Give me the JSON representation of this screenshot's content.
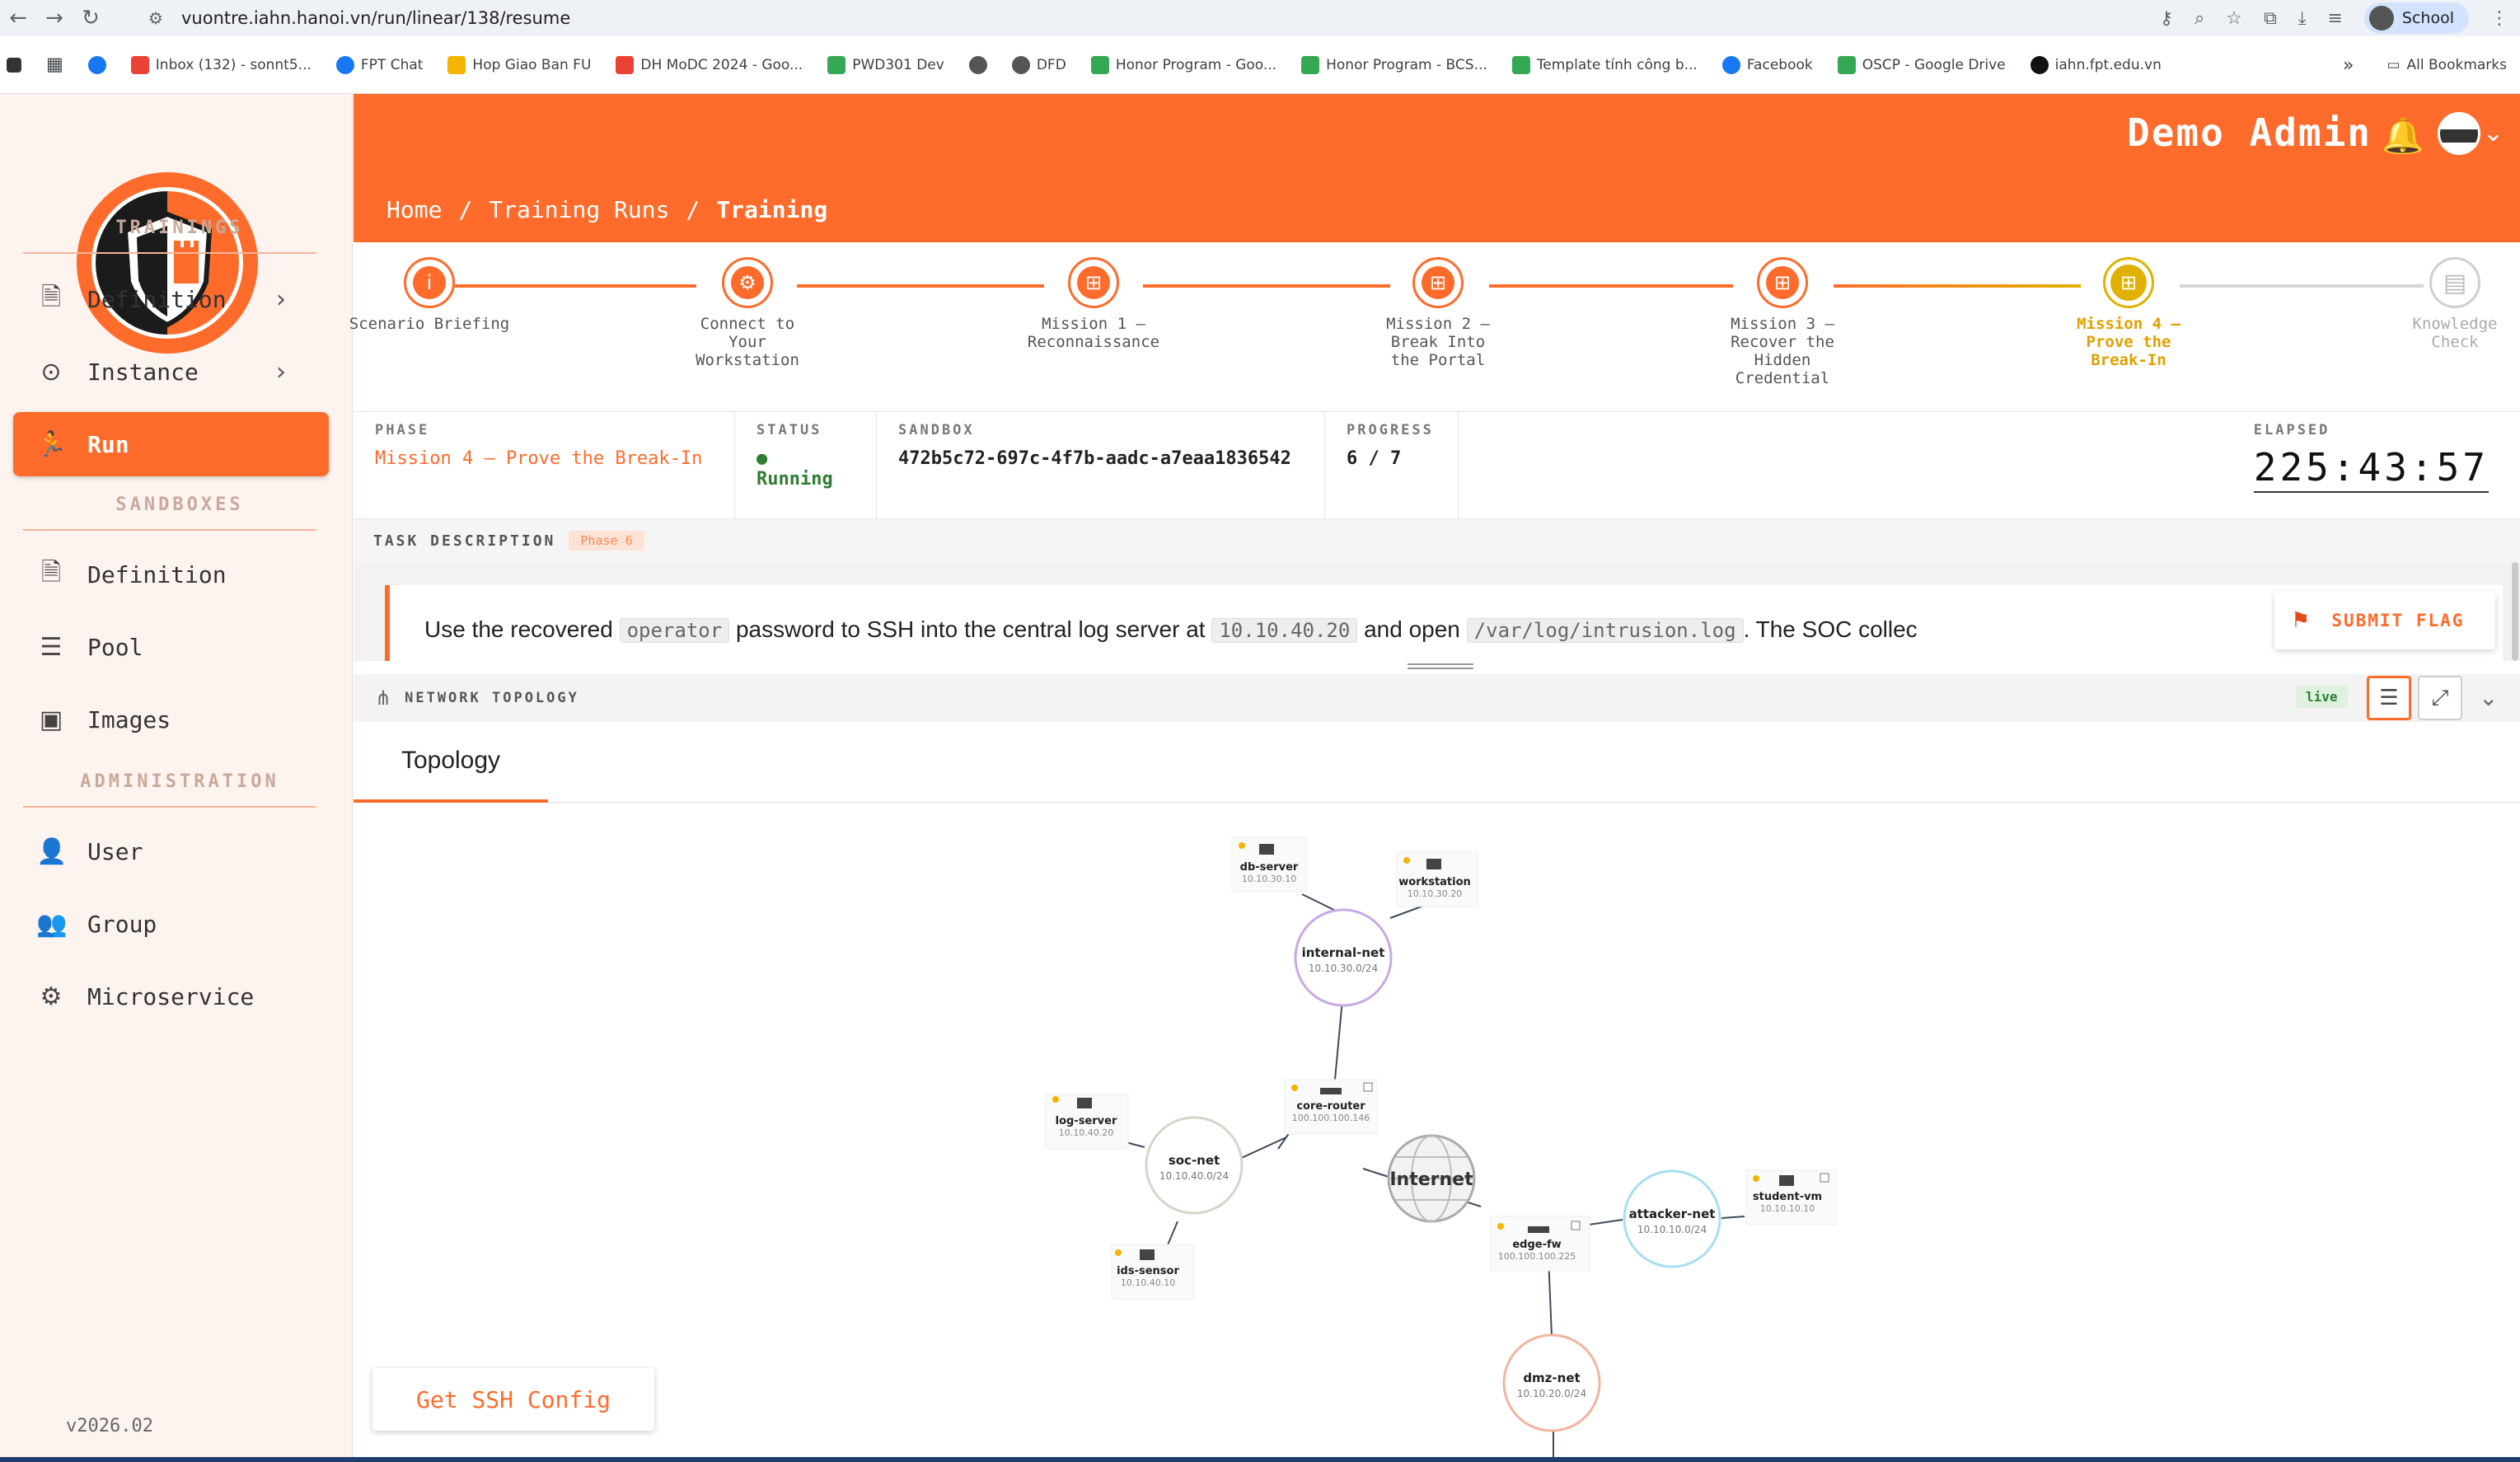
{
  "browser": {
    "url": "vuontre.iahn.hanoi.vn/run/linear/138/resume",
    "profile_label": "School",
    "bookmarks": [
      "Inbox (132) - sonnt5...",
      "FPT Chat",
      "Hop Giao Ban FU",
      "DH MoDC 2024 - Goo...",
      "PWD301 Dev",
      "DFD",
      "Honor Program - Goo...",
      "Honor Program - BCS...",
      "Template tính công b...",
      "Facebook",
      "OSCP - Google Drive",
      "iahn.fpt.edu.vn"
    ],
    "all_bookmarks": "All Bookmarks"
  },
  "header": {
    "user_name": "Demo Admin",
    "breadcrumb": [
      "Home",
      "Training Runs",
      "Training"
    ]
  },
  "sidebar": {
    "sections": [
      "TRAININGS",
      "SANDBOXES",
      "ADMINISTRATION"
    ],
    "trainings": [
      "Definition",
      "Instance",
      "Run"
    ],
    "sandboxes": [
      "Definition",
      "Pool",
      "Images"
    ],
    "administration": [
      "User",
      "Group",
      "Microservice"
    ],
    "version": "v2026.02"
  },
  "steps": [
    {
      "label": "Scenario Briefing",
      "state": "done",
      "icon": "info-icon"
    },
    {
      "label": "Connect to Your Workstation",
      "state": "done",
      "icon": "gear-icon"
    },
    {
      "label": "Mission 1 — Reconnaissance",
      "state": "done",
      "icon": "gamepad-icon"
    },
    {
      "label": "Mission 2 — Break Into the Portal",
      "state": "done",
      "icon": "gamepad-icon"
    },
    {
      "label": "Mission 3 — Recover the Hidden Credential",
      "state": "done",
      "icon": "gamepad-icon"
    },
    {
      "label": "Mission 4 — Prove the Break-In",
      "state": "current",
      "icon": "gamepad-icon"
    },
    {
      "label": "Knowledge Check",
      "state": "todo",
      "icon": "clipboard-icon"
    }
  ],
  "info": {
    "phase_label": "PHASE",
    "phase": "Mission 4 — Prove the Break-In",
    "status_label": "STATUS",
    "status": "Running",
    "sandbox_label": "SANDBOX",
    "sandbox": "472b5c72-697c-4f7b-aadc-a7eaa1836542",
    "progress_label": "PROGRESS",
    "progress": "6 / 7",
    "elapsed_label": "ELAPSED",
    "elapsed": "225:43:57"
  },
  "task": {
    "heading": "TASK DESCRIPTION",
    "phase_pill": "Phase 6",
    "text_1": "Use the recovered",
    "code_1": "operator",
    "text_2": "password to SSH into the central log server at",
    "code_2": "10.10.40.20",
    "text_3": "and open",
    "code_3": "/var/log/intrusion.log",
    "text_4": ". The SOC collec",
    "submit_label": "SUBMIT FLAG"
  },
  "topology": {
    "heading": "NETWORK TOPOLOGY",
    "live_badge": "live",
    "tab_label": "Topology",
    "networks": [
      {
        "name": "internal-net",
        "cidr": "10.10.30.0/24",
        "color": "#c9a8e8"
      },
      {
        "name": "soc-net",
        "cidr": "10.10.40.0/24",
        "color": "#d8d4c8"
      },
      {
        "name": "attacker-net",
        "cidr": "10.10.10.0/24",
        "color": "#a8def0"
      },
      {
        "name": "dmz-net",
        "cidr": "10.10.20.0/24",
        "color": "#f2b4a0"
      }
    ],
    "hosts": [
      {
        "name": "db-server",
        "ip": "10.10.30.10"
      },
      {
        "name": "workstation",
        "ip": "10.10.30.20"
      },
      {
        "name": "log-server",
        "ip": "10.10.40.20"
      },
      {
        "name": "ids-sensor",
        "ip": "10.10.40.10"
      },
      {
        "name": "student-vm",
        "ip": "10.10.10.10"
      }
    ],
    "routers": [
      {
        "name": "core-router",
        "ip": "100.100.100.146"
      },
      {
        "name": "edge-fw",
        "ip": "100.100.100.225"
      }
    ],
    "internet_label": "Internet",
    "ssh_button": "Get SSH Config"
  },
  "colors": {
    "accent": "#ff6b2b",
    "current_step": "#e0b100",
    "running": "#2e7d32"
  }
}
